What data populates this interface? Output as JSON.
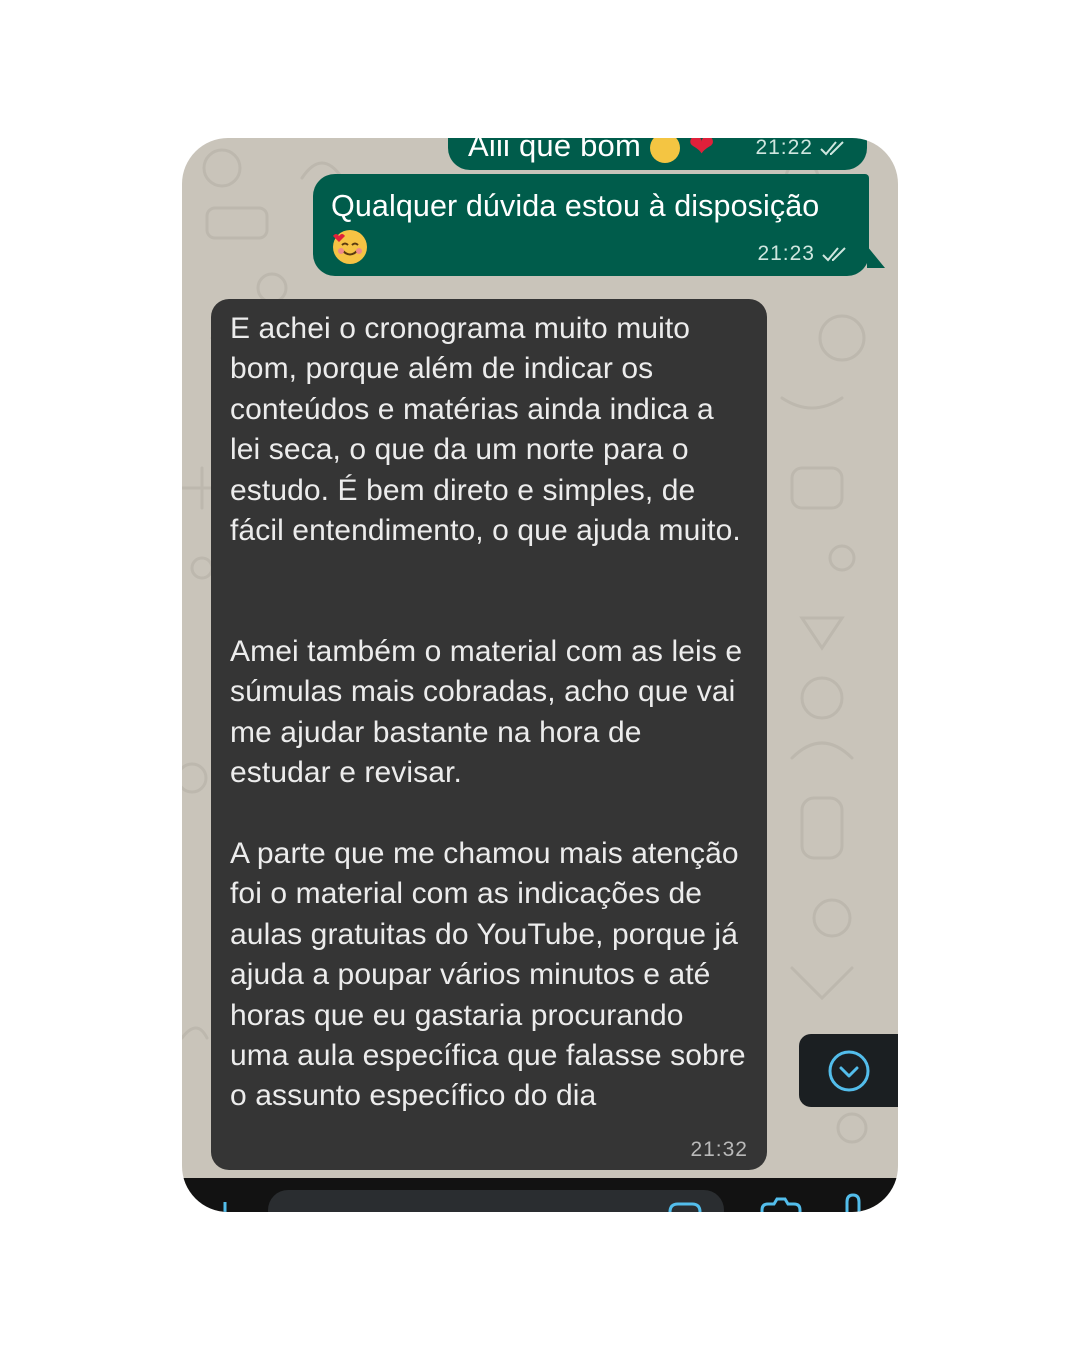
{
  "messages": [
    {
      "direction": "outgoing",
      "text": "Aiii que bom",
      "emoji": [
        "face-emoji",
        "red-heart-emoji"
      ],
      "time": "21:22",
      "status": "read"
    },
    {
      "direction": "outgoing",
      "text": "Qualquer dúvida estou à disposição",
      "emoji": [
        "smiling-face-with-hearts-emoji"
      ],
      "time": "21:23",
      "status": "read"
    },
    {
      "direction": "incoming",
      "paragraphs": [
        "E achei o cronograma muito muito bom, porque além de indicar os conteúdos e matérias ainda indica a lei seca, o que da um norte para o estudo. É bem direto e simples, de fácil entendimento, o que ajuda muito.",
        "Amei também o material com as leis e súmulas mais cobradas, acho que vai me ajudar bastante na hora de estudar e revisar.",
        "A parte que me chamou mais atenção foi o material com as indicações de aulas gratuitas do YouTube, porque já ajuda a poupar vários minutos e até horas que eu gastaria procurando uma aula específica que falasse sobre o assunto específico do dia"
      ],
      "time": "21:32"
    }
  ],
  "colors": {
    "outgoing_bubble": "#005c4b",
    "incoming_bubble": "#353535",
    "wallpaper": "#c9c4ba",
    "accent": "#53bdeb"
  },
  "icons": {
    "scroll_down": "chevron-down-circle-icon",
    "attach": "plus-icon",
    "sticker": "sticker-icon",
    "camera": "camera-icon",
    "mic": "microphone-icon",
    "read_receipt": "double-check-icon"
  }
}
